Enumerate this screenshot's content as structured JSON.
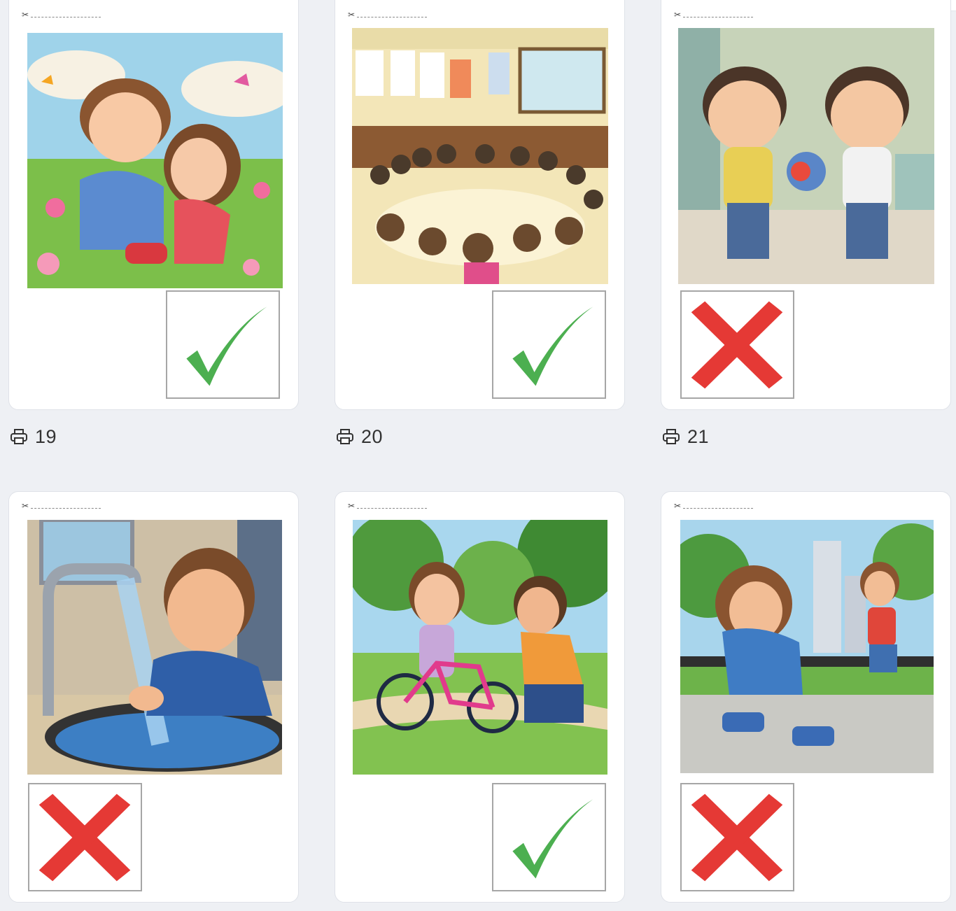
{
  "cards": [
    {
      "number": "19",
      "image": "Children hugging in flower meadow",
      "mark": "check-icon",
      "mark_color": "#4caf50"
    },
    {
      "number": "20",
      "image": "Children sitting in classroom circle",
      "mark": "check-icon",
      "mark_color": "#4caf50"
    },
    {
      "number": "21",
      "image": "Two boys pulling a toy",
      "mark": "cross-icon",
      "mark_color": "#e53935"
    },
    {
      "number": "",
      "image": "Boy splashing water from faucet",
      "mark": "cross-icon",
      "mark_color": "#e53935"
    },
    {
      "number": "",
      "image": "Boy helping girl on a bicycle",
      "mark": "check-icon",
      "mark_color": "#4caf50"
    },
    {
      "number": "",
      "image": "Boy laughing at hurt roller-skating girl",
      "mark": "cross-icon",
      "mark_color": "#e53935"
    }
  ],
  "icons": {
    "print": "printer-icon",
    "cut": "scissors-icon"
  }
}
